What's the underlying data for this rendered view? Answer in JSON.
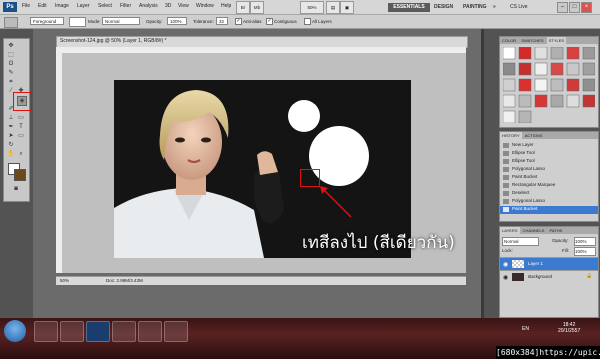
{
  "menubar": {
    "app_icon": "Ps",
    "items": [
      "File",
      "Edit",
      "Image",
      "Layer",
      "Select",
      "Filter",
      "Analysis",
      "3D",
      "View",
      "Window",
      "Help"
    ],
    "zoom_field": "50%",
    "workspaces": {
      "essentials": "ESSENTIALS",
      "design": "DESIGN",
      "painting": "PAINTING",
      "more": "»"
    },
    "cs_live": "CS Live",
    "window_controls": [
      "–",
      "□",
      "×"
    ]
  },
  "options": {
    "fill_source": "Foreground",
    "mode_label": "Mode:",
    "mode_value": "Normal",
    "opacity_label": "Opacity:",
    "opacity_value": "100%",
    "tolerance_label": "Tolerance:",
    "tolerance_value": "32",
    "antialias_label": "Anti-alias",
    "contiguous_label": "Contiguous",
    "all_layers_label": "All Layers"
  },
  "document": {
    "title": "Screenshot-124.jpg @ 50% (Layer 1, RGB/8#) *",
    "status_zoom": "50%",
    "status_doc": "Doc: 2.99M/3.43M"
  },
  "caption": "เทสีลงไป (สีเดียวกัน)",
  "right_panel": {
    "swatch_tabs": [
      "COLOR",
      "SWATCHES",
      "STYLES"
    ],
    "history_tabs": [
      "HISTORY",
      "ACTIONS"
    ],
    "history_items": [
      "New Layer",
      "Ellipse Tool",
      "Ellipse Tool",
      "Polygonal Lasso",
      "Paint Bucket",
      "Rectangular Marquee",
      "Deselect",
      "Polygonal Lasso",
      "Paint Bucket"
    ],
    "layers_tabs": [
      "LAYERS",
      "CHANNELS",
      "PATHS"
    ],
    "blend_mode": "Normal",
    "opacity_label": "Opacity:",
    "opacity_value": "100%",
    "lock_label": "Lock:",
    "fill_label": "Fill:",
    "fill_value": "100%",
    "layers": [
      "Layer 1",
      "Background"
    ]
  },
  "taskbar": {
    "lang": "EN",
    "time": "18:42",
    "date": "20/1/2557"
  },
  "watermark": "[680x384]https://upic.me/"
}
